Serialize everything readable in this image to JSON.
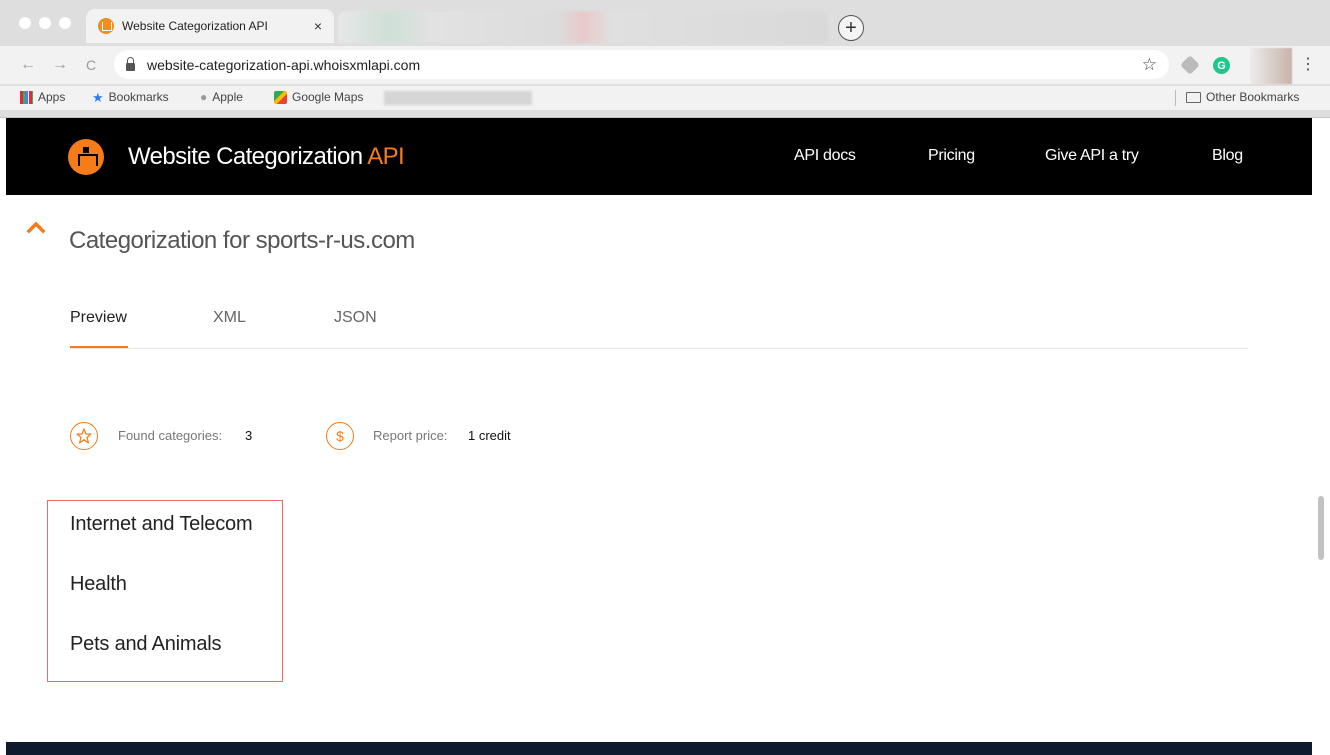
{
  "browser": {
    "tab_title": "Website Categorization API",
    "tab_close": "×",
    "new_tab": "+",
    "back": "←",
    "forward": "→",
    "reload": "C",
    "url": "website-categorization-api.whoisxmlapi.com",
    "bookmark_star": "☆",
    "extension_g": "G",
    "menu": "⋮",
    "bookmarks": {
      "apps": "Apps",
      "bookmarks": "Bookmarks",
      "apple": "Apple",
      "google_maps": "Google Maps",
      "other": "Other Bookmarks"
    }
  },
  "site": {
    "brand_main": "Website Categorization ",
    "brand_accent": "API",
    "brand_color": "#f57c19",
    "nav": {
      "api_docs": "API docs",
      "pricing": "Pricing",
      "try": "Give API a try",
      "blog": "Blog"
    }
  },
  "report": {
    "title": "Categorization for sports-r-us.com",
    "tabs": [
      "Preview",
      "XML",
      "JSON"
    ],
    "active_tab": "Preview",
    "found_label": "Found categories:",
    "found_value": "3",
    "price_label": "Report price:",
    "price_value": "1 credit",
    "price_icon": "$",
    "categories": [
      "Internet and Telecom",
      "Health",
      "Pets and Animals"
    ]
  }
}
